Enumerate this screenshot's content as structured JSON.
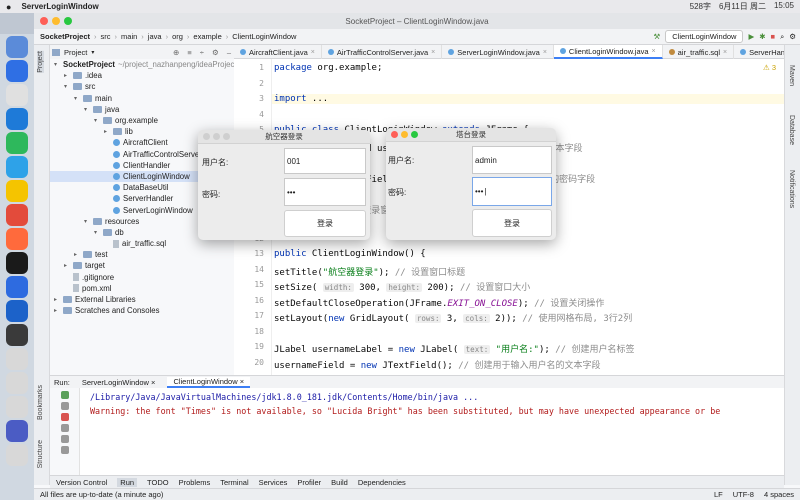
{
  "menubar": {
    "app": "ServerLoginWindow",
    "right": [
      "528字",
      "6月11日 周二",
      "15:05"
    ]
  },
  "window_title": "SocketProject – ClientLoginWindow.java",
  "breadcrumb": [
    "SocketProject",
    "src",
    "main",
    "java",
    "org",
    "example",
    "ClientLoginWindow"
  ],
  "run_config": "ClientLoginWindow",
  "project_label": "Project",
  "tabs": [
    "AircraftClient.java",
    "AirTrafficControlServer.java",
    "ServerLoginWindow.java",
    "ClientLoginWindow.java",
    "air_traffic.sql",
    "ServerHandler.java"
  ],
  "tree": [
    {
      "label": "SocketProject",
      "extra": "~/project_nazhanpeng/ideaProjects",
      "indent": 0,
      "type": "folder",
      "arrow": "▾"
    },
    {
      "label": ".idea",
      "indent": 1,
      "type": "folder",
      "arrow": "▸"
    },
    {
      "label": "src",
      "indent": 1,
      "type": "folder",
      "arrow": "▾"
    },
    {
      "label": "main",
      "indent": 2,
      "type": "folder",
      "arrow": "▾"
    },
    {
      "label": "java",
      "indent": 3,
      "type": "folder",
      "arrow": "▾"
    },
    {
      "label": "org.example",
      "indent": 4,
      "type": "folder",
      "arrow": "▾"
    },
    {
      "label": "lib",
      "indent": 5,
      "type": "folder",
      "arrow": "▸"
    },
    {
      "label": "AircraftClient",
      "indent": 5,
      "type": "class"
    },
    {
      "label": "AirTrafficControlServer",
      "indent": 5,
      "type": "class"
    },
    {
      "label": "ClientHandler",
      "indent": 5,
      "type": "class"
    },
    {
      "label": "ClientLoginWindow",
      "indent": 5,
      "type": "class",
      "selected": true
    },
    {
      "label": "DataBaseUtil",
      "indent": 5,
      "type": "class"
    },
    {
      "label": "ServerHandler",
      "indent": 5,
      "type": "class"
    },
    {
      "label": "ServerLoginWindow",
      "indent": 5,
      "type": "class"
    },
    {
      "label": "resources",
      "indent": 3,
      "type": "folder",
      "arrow": "▾"
    },
    {
      "label": "db",
      "indent": 4,
      "type": "folder",
      "arrow": "▾"
    },
    {
      "label": "air_traffic.sql",
      "indent": 5,
      "type": "file"
    },
    {
      "label": "test",
      "indent": 2,
      "type": "folder",
      "arrow": "▸"
    },
    {
      "label": "target",
      "indent": 1,
      "type": "folder",
      "arrow": "▸"
    },
    {
      "label": ".gitignore",
      "indent": 1,
      "type": "file"
    },
    {
      "label": "pom.xml",
      "indent": 1,
      "type": "file"
    },
    {
      "label": "External Libraries",
      "indent": 0,
      "type": "folder",
      "arrow": "▸"
    },
    {
      "label": "Scratches and Consoles",
      "indent": 0,
      "type": "folder",
      "arrow": "▸"
    }
  ],
  "editor": {
    "warnings": "⚠ 3",
    "lines": [
      {
        "n": "1",
        "html": "<span class='kw'>package</span> org.example;"
      },
      {
        "n": "2",
        "html": ""
      },
      {
        "n": "3",
        "html": "<span class='kw'>import</span> ..."
      },
      {
        "n": "4",
        "html": ""
      },
      {
        "n": "5",
        "html": "<span class='kw'>public class</span> ClientLoginWindow <span class='kw'>extends</span> JFrame {"
      },
      {
        "n": "6",
        "html": "    <span class='kw'>private</span> JTextField usernameField; <span class='cmt'>// 用于输入用户名的文本字段</span>"
      },
      {
        "n": "7",
        "html": ""
      },
      {
        "n": "8",
        "html": "    <span class='kw'>private</span> JPasswordField passwordField; <span class='cmt'>// 用于输入密码的密码字段</span>"
      },
      {
        "n": "9",
        "html": ""
      },
      {
        "n": "10",
        "html": "    <span class='cmt'>// 构造函数，初始化登录窗口</span>"
      },
      {
        "n": "11",
        "html": ""
      },
      {
        "n": "12",
        "html": ""
      },
      {
        "n": "13",
        "html": "    <span class='kw'>public</span> ClientLoginWindow() {"
      },
      {
        "n": "14",
        "html": "        setTitle(<span class='str'>\"航空器登录\"</span>); <span class='cmt'>// 设置窗口标题</span>"
      },
      {
        "n": "15",
        "html": "        setSize( <span class='hint'>width:</span> 300,  <span class='hint'>height:</span> 200); <span class='cmt'>// 设置窗口大小</span>"
      },
      {
        "n": "16",
        "html": "        setDefaultCloseOperation(JFrame.<i style='color:#871094'>EXIT_ON_CLOSE</i>); <span class='cmt'>// 设置关闭操作</span>"
      },
      {
        "n": "17",
        "html": "        setLayout(<span class='kw'>new</span> GridLayout( <span class='hint'>rows:</span> 3,  <span class='hint'>cols:</span> 2)); <span class='cmt'>// 使用网格布局, 3行2列</span>"
      },
      {
        "n": "18",
        "html": ""
      },
      {
        "n": "19",
        "html": "        JLabel usernameLabel = <span class='kw'>new</span> JLabel( <span class='hint'>text:</span> <span class='str'>\"用户名:\"</span>); <span class='cmt'>// 创建用户名标签</span>"
      },
      {
        "n": "20",
        "html": "        usernameField = <span class='kw'>new</span> JTextField(); <span class='cmt'>// 创建用于输入用户名的文本字段</span>"
      }
    ]
  },
  "run": {
    "label": "Run:",
    "tabs": [
      "ServerLoginWindow",
      "ClientLoginWindow"
    ],
    "console": [
      "/Library/Java/JavaVirtualMachines/jdk1.8.0_181.jdk/Contents/Home/bin/java ...",
      "Warning: the font \"Times\" is not available, so \"Lucida Bright\" has been substituted, but may have unexpected appearance or be"
    ]
  },
  "toolwindows": [
    "Version Control",
    "Run",
    "TODO",
    "Problems",
    "Terminal",
    "Services",
    "Profiler",
    "Build",
    "Dependencies"
  ],
  "status": {
    "left": "All files are up-to-date (a minute ago)",
    "right": [
      "LF",
      "UTF-8",
      "4 spaces"
    ]
  },
  "left_strip": [
    "Project",
    "Bookmarks",
    "Structure"
  ],
  "right_strip": [
    "Maven",
    "Database",
    "Notifications"
  ],
  "dialog_aircraft": {
    "title": "航空器登录",
    "username_label": "用户名:",
    "username_value": "001",
    "password_label": "密码:",
    "password_value": "•••",
    "button": "登录"
  },
  "dialog_tower": {
    "title": "塔台登录",
    "username_label": "用户名:",
    "username_value": "admin",
    "password_label": "密码:",
    "password_value": "•••",
    "button": "登录"
  }
}
